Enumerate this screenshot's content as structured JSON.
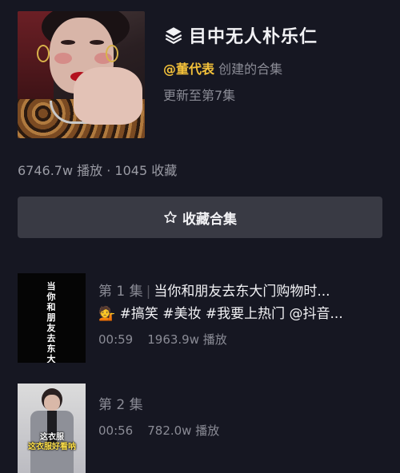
{
  "collection": {
    "title": "目中无人朴乐仁",
    "creator_handle": "@董代表",
    "creator_suffix": "创建的合集",
    "update_status": "更新至第7集",
    "stats": "6746.7w 播放 · 1045 收藏",
    "title_icon": "layers-icon"
  },
  "collect_button": {
    "label": "收藏合集",
    "icon": "star-outline-icon"
  },
  "episodes": [
    {
      "number": "第 1 集",
      "title": "当你和朋友去东大门购物时...",
      "line2": "💁 #搞笑 #美妆 #我要上热门 @抖音...",
      "duration": "00:59",
      "plays": "1963.9w 播放",
      "thumb_text": "当你和朋友去东大门"
    },
    {
      "number": "第 2 集",
      "title": "",
      "duration": "00:56",
      "plays": "782.0w 播放",
      "thumb_caption_1": "这衣服",
      "thumb_caption_2": "这衣服好看呐"
    }
  ],
  "colors": {
    "background": "#161722",
    "button_bg": "#393a44",
    "accent_handle": "#f3c13a",
    "secondary_text": "#8a8b95"
  }
}
